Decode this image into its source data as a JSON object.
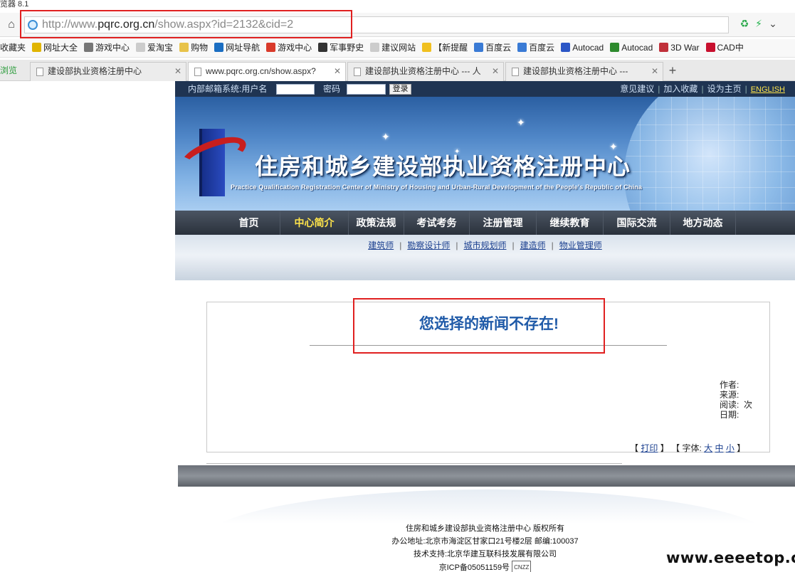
{
  "window_title": "览器 8.1",
  "address": {
    "url_prefix": "http://www.",
    "url_host": "pqrc.org.cn",
    "url_path": "/show.aspx?id=2132&cid=2"
  },
  "bookmarks": [
    "收藏夹",
    "网址大全",
    "游戏中心",
    "爱淘宝",
    "购物",
    "网址导航",
    "游戏中心",
    "军事野史",
    "建议网站",
    "【新提醒",
    "百度云",
    "百度云",
    "Autocad",
    "Autocad",
    "3D War",
    "CAD中"
  ],
  "tabs": {
    "side_label": "浏览",
    "items": [
      "建设部执业资格注册中心",
      "www.pqrc.org.cn/show.aspx?",
      "建设部执业资格注册中心 --- 人",
      "建设部执业资格注册中心 ---"
    ]
  },
  "site": {
    "login_label": "内部邮箱系统:用户名",
    "password_label": "密码",
    "login_button": "登录",
    "top_links": [
      "意见建议",
      "加入收藏",
      "设为主页"
    ],
    "english_link": "ENGLISH",
    "banner_title": "住房和城乡建设部执业资格注册中心",
    "banner_subtitle": "Practice Qualification Registration Center of Ministry of Housing and Urban-Rural Development of the People's Republic of China",
    "nav": [
      "首页",
      "中心简介",
      "政策法规",
      "考试考务",
      "注册管理",
      "继续教育",
      "国际交流",
      "地方动态"
    ],
    "subnav": [
      "建筑师",
      "勘察设计师",
      "城市规划师",
      "建造师",
      "物业管理师"
    ],
    "news_title": "您选择的新闻不存在!",
    "meta": {
      "author": "作者:",
      "source": "来源:",
      "reads": "阅读:",
      "reads_unit": "次",
      "date": "日期:"
    },
    "print": {
      "open": "【",
      "print": "打印",
      "close": "】",
      "font_label": "字体:",
      "large": "大",
      "medium": "中",
      "small": "小"
    },
    "footer": {
      "line1": "住房和城乡建设部执业资格注册中心 版权所有",
      "line2": "办公地址:北京市海淀区甘家口21号楼2层 邮编:100037",
      "line3": "技术支持:北京华建互联科技发展有限公司",
      "line4": "京ICP备05051159号",
      "badge": "CNZZ"
    }
  },
  "watermark": "www.eeeetop.com"
}
